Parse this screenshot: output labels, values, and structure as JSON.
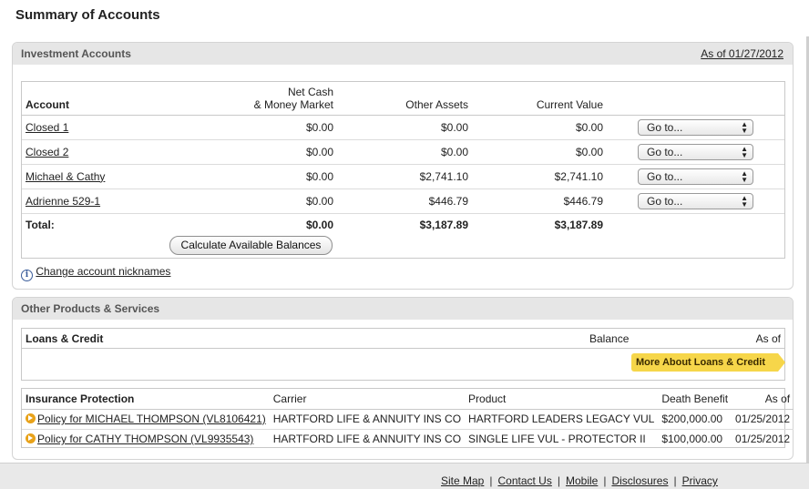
{
  "page_title": "Summary of Accounts",
  "investment": {
    "title": "Investment Accounts",
    "as_of": "As of 01/27/2012",
    "columns": {
      "account": "Account",
      "net_cash_1": "Net Cash",
      "net_cash_2": "& Money Market",
      "other_assets": "Other Assets",
      "current_value": "Current Value"
    },
    "rows": [
      {
        "name": "Closed 1",
        "net_cash": "$0.00",
        "other": "$0.00",
        "current": "$0.00",
        "select": "Go to..."
      },
      {
        "name": "Closed 2",
        "net_cash": "$0.00",
        "other": "$0.00",
        "current": "$0.00",
        "select": "Go to..."
      },
      {
        "name": "Michael & Cathy",
        "net_cash": "$0.00",
        "other": "$2,741.10",
        "current": "$2,741.10",
        "select": "Go to..."
      },
      {
        "name": "Adrienne 529-1",
        "net_cash": "$0.00",
        "other": "$446.79",
        "current": "$446.79",
        "select": "Go to..."
      }
    ],
    "total": {
      "label": "Total:",
      "net_cash": "$0.00",
      "other": "$3,187.89",
      "current": "$3,187.89"
    },
    "calc_button": "Calculate Available Balances",
    "nickname_link": "Change account nicknames"
  },
  "other_products": {
    "title": "Other Products & Services",
    "loans": {
      "title": "Loans & Credit",
      "balance": "Balance",
      "as_of": "As of",
      "button": "More About Loans & Credit"
    },
    "insurance": {
      "columns": {
        "title": "Insurance Protection",
        "carrier": "Carrier",
        "product": "Product",
        "death_benefit": "Death Benefit",
        "as_of": "As of"
      },
      "rows": [
        {
          "policy": "Policy for MICHAEL THOMPSON (VL8106421)",
          "carrier": "HARTFORD LIFE & ANNUITY INS CO",
          "product": "HARTFORD LEADERS LEGACY VUL",
          "benefit": "$200,000.00",
          "as_of": "01/25/2012"
        },
        {
          "policy": "Policy for CATHY THOMPSON (VL9935543)",
          "carrier": "HARTFORD LIFE & ANNUITY INS CO",
          "product": "SINGLE LIFE VUL - PROTECTOR II",
          "benefit": "$100,000.00",
          "as_of": "01/25/2012"
        }
      ]
    }
  },
  "footer": {
    "links": [
      "Site Map",
      "Contact Us",
      "Mobile",
      "Disclosures",
      "Privacy"
    ],
    "separator": "|"
  },
  "icons": {
    "info": "info-icon",
    "policy": "arrow-circle-icon",
    "select": "updown-arrows-icon"
  },
  "colors": {
    "loan_button": "#f6d64a",
    "panel_header": "#e6e6e6",
    "policy_icon": "#e8a21a"
  }
}
